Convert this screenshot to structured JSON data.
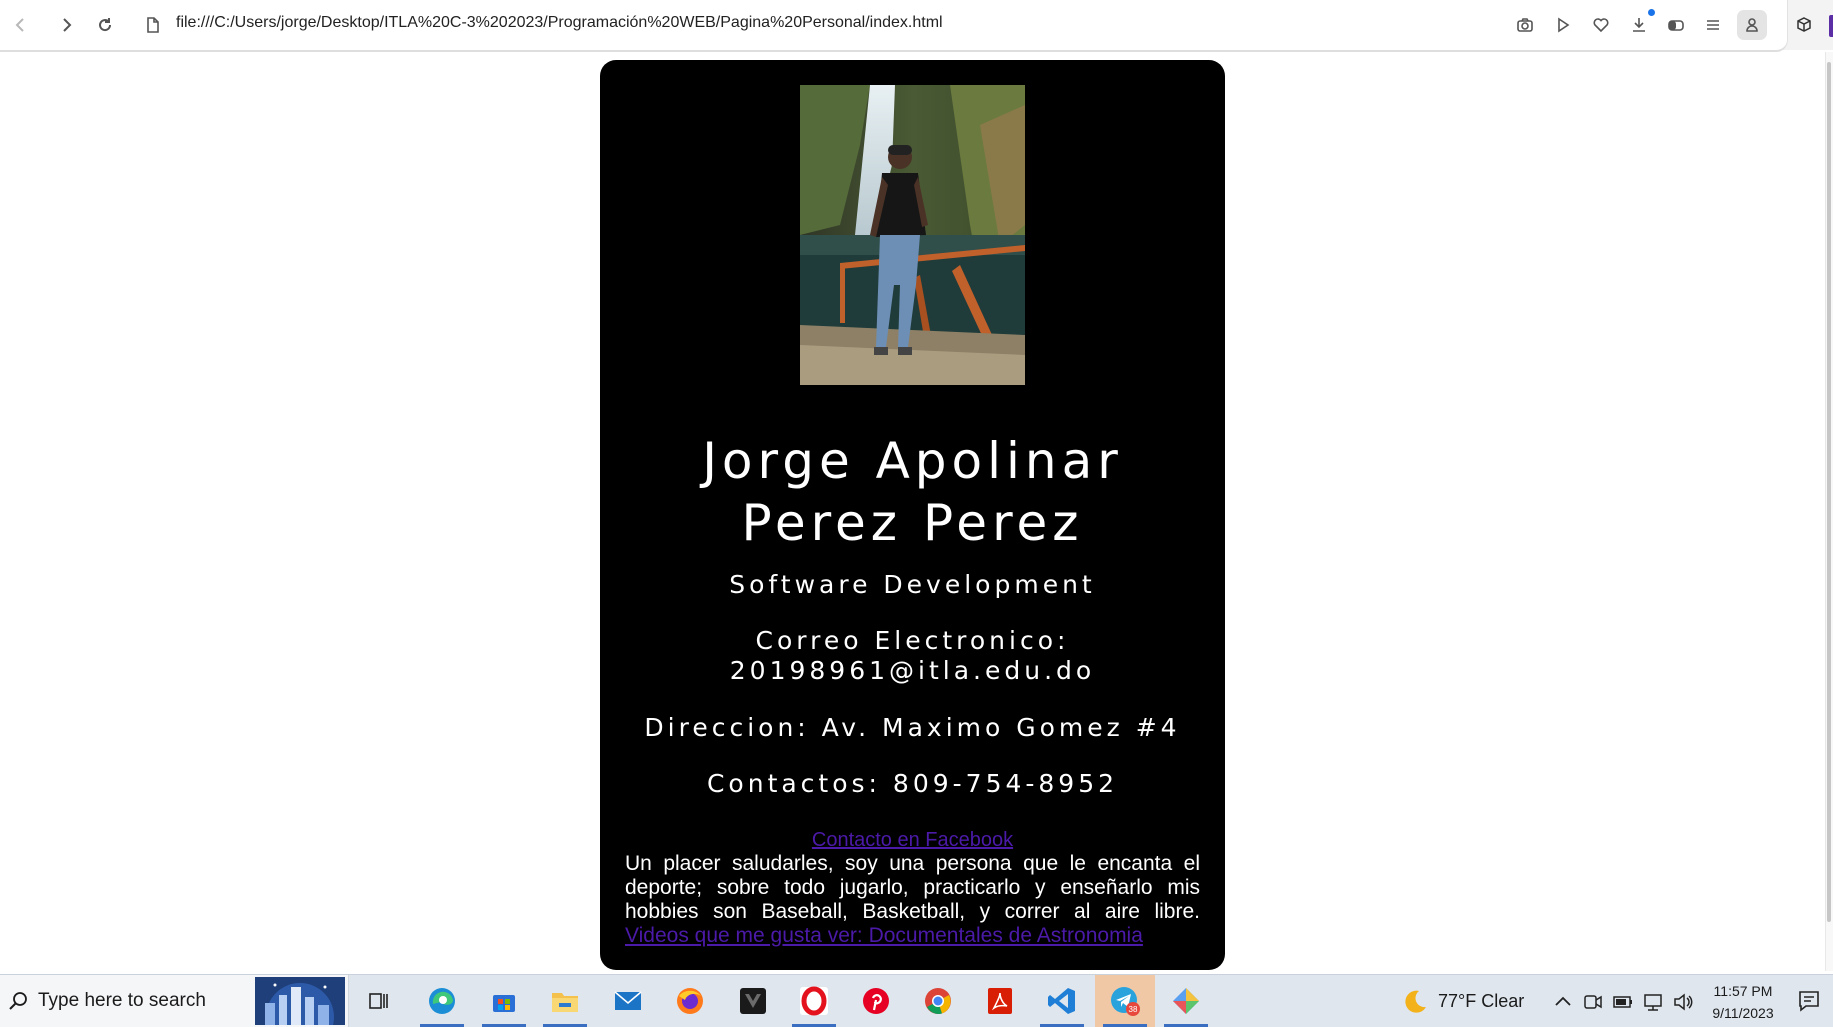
{
  "browser": {
    "url": "file:///C:/Users/jorge/Desktop/ITLA%20C-3%202023/Programación%20WEB/Pagina%20Personal/index.html",
    "icons": [
      "back-icon",
      "forward-icon",
      "reload-icon",
      "file-icon",
      "camera-icon",
      "play-icon",
      "heart-icon",
      "download-icon",
      "sidebar-toggle-icon",
      "menu-icon",
      "profile-icon",
      "extension-cube-icon"
    ]
  },
  "profile": {
    "name_line1": "Jorge Apolinar",
    "name_line2": "Perez Perez",
    "role": "Software Development",
    "email_label": "Correo Electronico:",
    "email": "20198961@itla.edu.do",
    "address": "Direccion: Av. Maximo Gomez #4",
    "contacts": "Contactos: 809-754-8952",
    "facebook_link": "Contacto en Facebook",
    "bio_line1": "Un placer saludarles, soy una persona que le encanta el",
    "bio_line2": "deporte; sobre todo jugarlo, practicarlo y enseñarlo mis",
    "bio_line3": "hobbies son Baseball, Basketball, y correr al aire libre.",
    "videos_link": "Videos que me gusta ver: Documentales de Astronomia",
    "photo": "profile-photo-waterfall"
  },
  "colors": {
    "card_background": "#000000",
    "card_text": "#ffffff",
    "link": "#4b1aa8"
  },
  "taskbar": {
    "search_placeholder": "Type here to search",
    "apps": [
      "task-view",
      "edge",
      "microsoft-store",
      "file-explorer",
      "mail",
      "firefox",
      "game-app",
      "opera",
      "pinterest",
      "chrome",
      "acrobat",
      "vscode",
      "telegram",
      "colorful-app"
    ],
    "telegram_badge": "38",
    "weather": "77°F  Clear",
    "time": "11:57 PM",
    "date": "9/11/2023"
  }
}
